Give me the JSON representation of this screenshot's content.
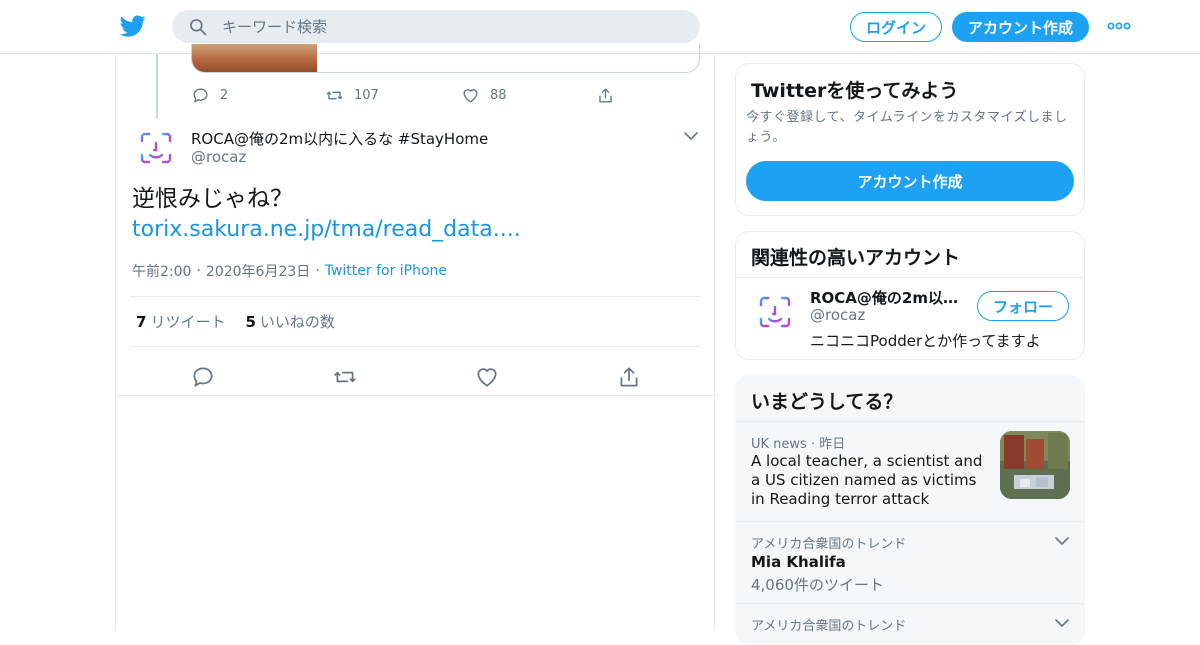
{
  "header": {
    "logo": "twitter-bird-icon",
    "search_placeholder": "キーワード検索",
    "login_label": "ログイン",
    "signup_label": "アカウント作成",
    "more_icon": "more-dots-icon",
    "accent_color": "#1da1f2"
  },
  "previous_tweet": {
    "reply_count": "2",
    "retweet_count": "107",
    "like_count": "88"
  },
  "tweet": {
    "author_name": "ROCA@俺の2m以内に入るな #StayHome",
    "author_handle": "@rocaz",
    "text": "逆恨みじゃね？",
    "link": "torix.sakura.ne.jp/tma/read_data....",
    "time": "午前2:00",
    "date": "2020年6月23日",
    "source": "Twitter for iPhone",
    "retweets_number": "7",
    "retweets_label": "リツイート",
    "likes_number": "5",
    "likes_label": "いいねの数"
  },
  "sidebar": {
    "signup_card": {
      "title": "Twitterを使ってみよう",
      "description": "今すぐ登録して、タイムラインをカスタマイズしましょう。",
      "button_label": "アカウント作成"
    },
    "related": {
      "title": "関連性の高いアカウント",
      "account_name": "ROCA@俺の2m以内...",
      "account_handle": "@rocaz",
      "account_bio": "ニコニコPodderとか作ってますよ",
      "follow_label": "フォロー"
    },
    "trends": {
      "title": "いまどうしてる？",
      "items": [
        {
          "source": "UK news",
          "time": "昨日",
          "headline": "A local teacher, a scientist and a US citizen named as victims in Reading terror attack"
        },
        {
          "context": "アメリカ合衆国のトレンド",
          "name": "Mia Khalifa",
          "count": "4,060件のツイート"
        },
        {
          "context": "アメリカ合衆国のトレンド"
        }
      ]
    }
  }
}
